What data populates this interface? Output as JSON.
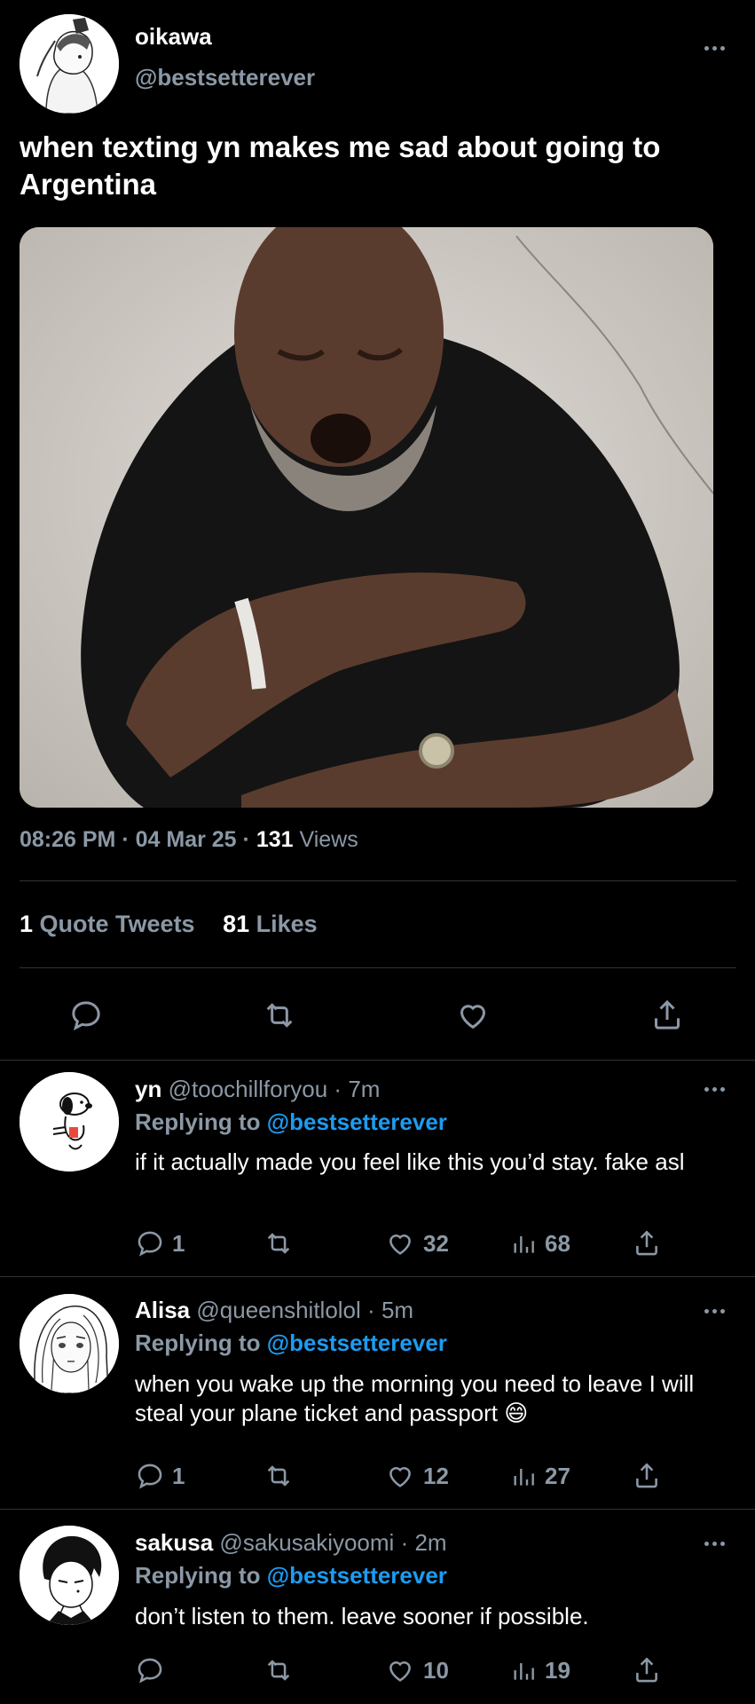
{
  "tweet": {
    "display_name": "oikawa",
    "handle": "@bestsetterever",
    "text": "when texting yn makes me sad about going to Argentina",
    "time": "08:26 PM",
    "date": "04 Mar 25",
    "views_count": "131",
    "views_label": "Views",
    "quote_count": "1",
    "quote_label": "Quote Tweets",
    "likes_count": "81",
    "likes_label": "Likes"
  },
  "replies": [
    {
      "display_name": "yn",
      "handle": "@toochillforyou",
      "time": "7m",
      "replying_label": "Replying to",
      "replying_to": "@bestsetterever",
      "text": "if it actually made you feel like this you’d stay. fake asl",
      "reply_count": "1",
      "like_count": "32",
      "view_count": "68"
    },
    {
      "display_name": "Alisa",
      "handle": "@queenshitlolol",
      "time": "5m",
      "replying_label": "Replying to",
      "replying_to": "@bestsetterever",
      "text": "when you wake up the morning you need to leave I will steal your plane ticket and passport 😄",
      "reply_count": "1",
      "like_count": "12",
      "view_count": "27"
    },
    {
      "display_name": "sakusa",
      "handle": "@sakusakiyoomi",
      "time": "2m",
      "replying_label": "Replying to",
      "replying_to": "@bestsetterever",
      "text": "don’t listen to them. leave sooner if possible.",
      "reply_count": "",
      "like_count": "10",
      "view_count": "19"
    }
  ],
  "icons": {
    "reply": "reply-icon",
    "retweet": "retweet-icon",
    "like": "heart-icon",
    "views": "views-icon",
    "share": "share-icon",
    "more": "more-icon"
  },
  "colors": {
    "background": "#000000",
    "text": "#ffffff",
    "muted": "#8b98a5",
    "link": "#1d9bf0",
    "divider": "#2f3336"
  }
}
